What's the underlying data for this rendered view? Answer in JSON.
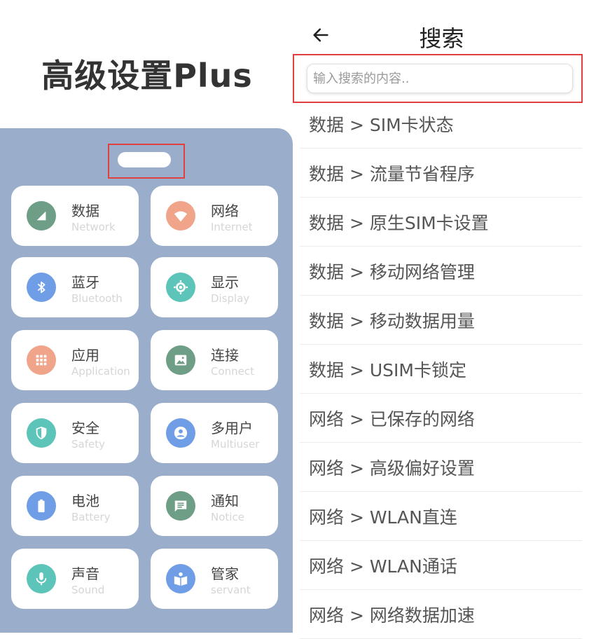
{
  "left": {
    "app_title": "高级设置Plus",
    "tiles": [
      {
        "zh": "数据",
        "en": "Network",
        "icon": "signal-icon",
        "color": "#6f9e86"
      },
      {
        "zh": "网络",
        "en": "Internet",
        "icon": "wifi-icon",
        "color": "#f0a58a"
      },
      {
        "zh": "蓝牙",
        "en": "Bluetooth",
        "icon": "bluetooth-icon",
        "color": "#6f9de6"
      },
      {
        "zh": "显示",
        "en": "Display",
        "icon": "brightness-icon",
        "color": "#5cc4b8"
      },
      {
        "zh": "应用",
        "en": "Application",
        "icon": "apps-grid-icon",
        "color": "#f0a58a"
      },
      {
        "zh": "连接",
        "en": "Connect",
        "icon": "image-icon",
        "color": "#6f9e86"
      },
      {
        "zh": "安全",
        "en": "Safety",
        "icon": "shield-icon",
        "color": "#5cc4b8"
      },
      {
        "zh": "多用户",
        "en": "Multiuser",
        "icon": "user-icon",
        "color": "#6f9de6"
      },
      {
        "zh": "电池",
        "en": "Battery",
        "icon": "battery-icon",
        "color": "#6f9de6"
      },
      {
        "zh": "通知",
        "en": "Notice",
        "icon": "message-icon",
        "color": "#6f9e86"
      },
      {
        "zh": "声音",
        "en": "Sound",
        "icon": "microphone-icon",
        "color": "#5cc4b8"
      },
      {
        "zh": "管家",
        "en": "servant",
        "icon": "book-icon",
        "color": "#6f9de6"
      }
    ]
  },
  "right": {
    "page_title": "搜索",
    "search_placeholder": "输入搜索的内容..",
    "search_value": "",
    "results": [
      "数据 > SIM卡状态",
      "数据 > 流量节省程序",
      "数据 > 原生SIM卡设置",
      "数据 > 移动网络管理",
      "数据 > 移动数据用量",
      "数据 > USIM卡锁定",
      "网络 > 已保存的网络",
      "网络 > 高级偏好设置",
      "网络 > WLAN直连",
      "网络 > WLAN通话",
      "网络 > 网络数据加速"
    ]
  },
  "colors": {
    "panel_bg": "#9aaecb",
    "highlight_border": "#e04040"
  }
}
